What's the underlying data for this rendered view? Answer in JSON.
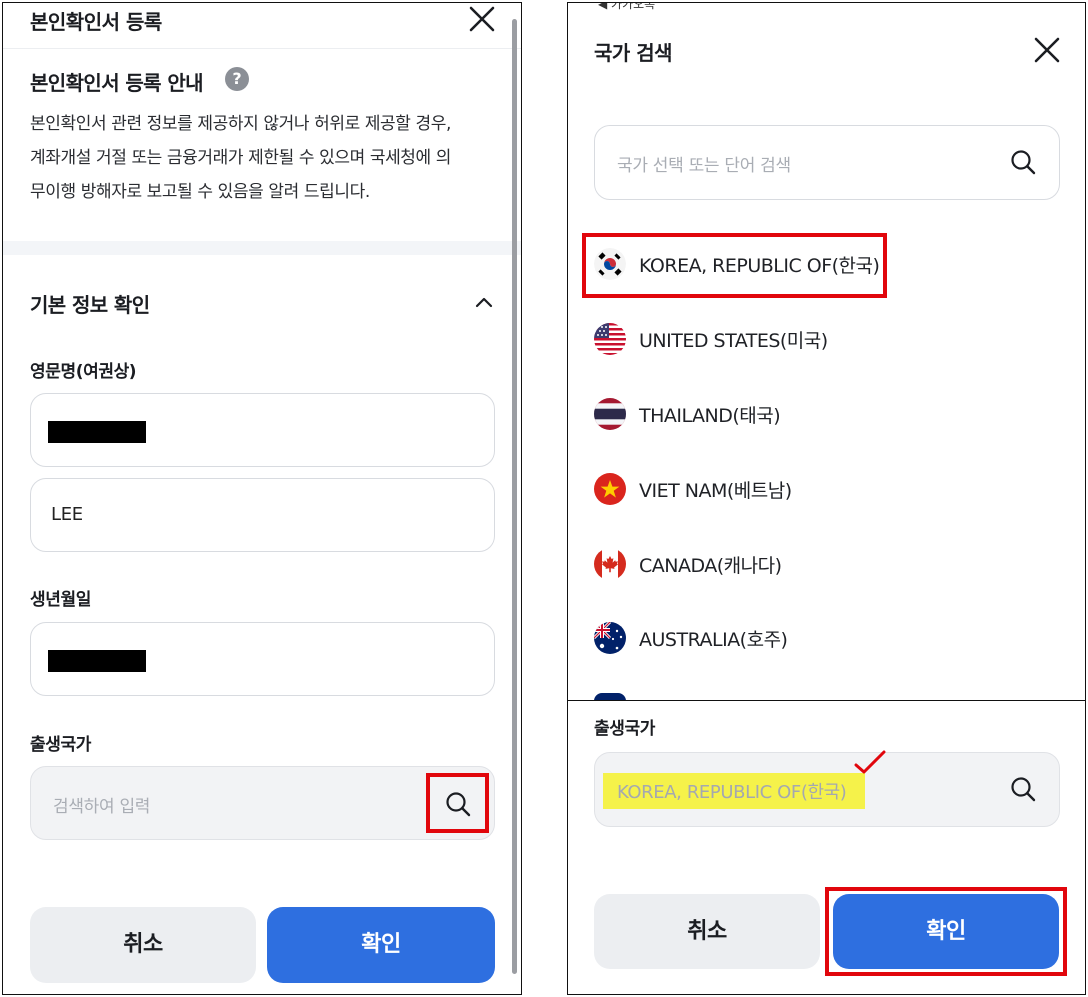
{
  "left": {
    "title": "본인확인서 등록",
    "notice_heading": "본인확인서 등록 안내",
    "info_icon_glyph": "?",
    "notice_lines": [
      "본인확인서 관련 정보를 제공하지 않거나 허위로 제공할 경우,",
      "계좌개설 거절 또는 금융거래가 제한될 수 있으며 국세청에 의",
      "무이행 방해자로 보고될 수 있음을 알려 드립니다."
    ],
    "section_title": "기본 정보 확인",
    "english_name_label": "영문명(여권상)",
    "last_name_value": "LEE",
    "birth_label": "생년월일",
    "birth_country_label": "출생국가",
    "birth_country_placeholder": "검색하여 입력",
    "cancel_label": "취소",
    "confirm_label": "확인"
  },
  "right": {
    "back_text": "◀ 카카오톡",
    "title": "국가 검색",
    "search_placeholder": "국가 선택 또는 단어 검색",
    "countries": [
      {
        "name": "KOREA, REPUBLIC OF(한국)",
        "icon": "flag-korea"
      },
      {
        "name": "UNITED STATES(미국)",
        "icon": "flag-usa"
      },
      {
        "name": "THAILAND(태국)",
        "icon": "flag-thailand"
      },
      {
        "name": "VIET NAM(베트남)",
        "icon": "flag-vietnam"
      },
      {
        "name": "CANADA(캐나다)",
        "icon": "flag-canada"
      },
      {
        "name": "AUSTRALIA(호주)",
        "icon": "flag-australia"
      }
    ],
    "birth_country_label": "출생국가",
    "selected_country": "KOREA, REPUBLIC OF(한국)",
    "cancel_label": "취소",
    "confirm_label": "확인"
  },
  "colors": {
    "primary": "#2e6fe0",
    "annotation_red": "#e1060c",
    "highlight_yellow": "#f5f24a"
  }
}
